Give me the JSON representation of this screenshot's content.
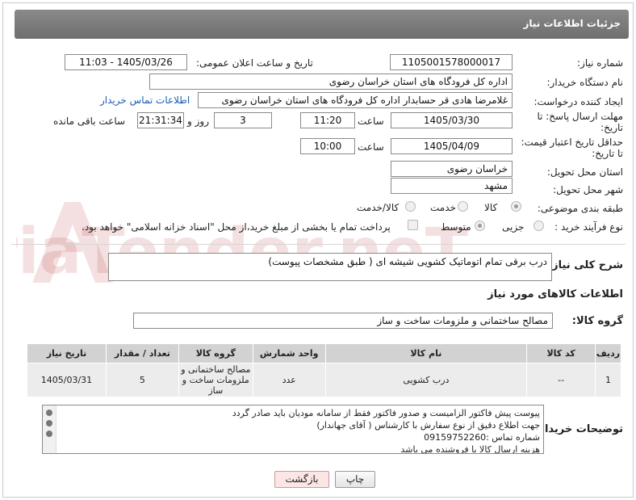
{
  "header": {
    "title": "جزئیات اطلاعات نیاز"
  },
  "fields": {
    "need_number_label": "شماره نیاز:",
    "need_number": "1105001578000017",
    "announce_label": "تاریخ و ساعت اعلان عمومی:",
    "announce_value": "1405/03/26 - 11:03",
    "buyer_org_label": "نام دستگاه خریدار:",
    "buyer_org": "اداره کل فرودگاه های استان خراسان رضوی",
    "creator_label": "ایجاد کننده درخواست:",
    "creator": "غلامرضا هادی قر حسابدار اداره کل فرودگاه های استان خراسان رضوی",
    "buyer_contact_link": "اطلاعات تماس خریدار",
    "deadline_label_1": "مهلت ارسال پاسخ: تا",
    "deadline_label_2": "تاریخ:",
    "deadline_date": "1405/03/30",
    "time_label": "ساعت",
    "deadline_time": "11:20",
    "days_value": "3",
    "days_label": "روز و",
    "remaining_time": "21:31:34",
    "remaining_label": "ساعت باقی مانده",
    "validity_label_1": "حداقل تاریخ اعتبار قیمت:",
    "validity_label_2": "تا تاریخ:",
    "validity_date": "1405/04/09",
    "validity_time": "10:00",
    "province_label": "استان محل تحویل:",
    "province": "خراسان رضوی",
    "city_label": "شهر محل تحویل:",
    "city": "مشهد",
    "category_label": "طبقه بندی موضوعی:",
    "category_options": [
      "کالا",
      "خدمت",
      "کالا/خدمت"
    ],
    "process_label": "نوع فرآیند خرید :",
    "process_options": [
      "جزیی",
      "متوسط"
    ],
    "payment_note": "پرداخت تمام یا بخشی از مبلغ خرید،از محل \"اسناد خزانه اسلامی\" خواهد بود."
  },
  "summary": {
    "label": "شرح کلی نیاز:",
    "text": "درب برقی تمام اتوماتیک کشویی شیشه ای ( طبق مشخصات پیوست)"
  },
  "goods_info_title": "اطلاعات کالاهای مورد نیاز",
  "goods_group": {
    "label": "گروه کالا:",
    "value": "مصالح ساختمانی و ملزومات ساخت و ساز"
  },
  "table": {
    "headers": [
      "ردیف",
      "کد کالا",
      "نام کالا",
      "واحد شمارش",
      "گروه کالا",
      "تعداد / مقدار",
      "تاریخ نیاز"
    ],
    "rows": [
      [
        "1",
        "--",
        "درب کشویی",
        "عدد",
        "مصالح ساختمانی و ملزومات ساخت و ساز",
        "5",
        "1405/03/31"
      ]
    ]
  },
  "buyer_notes": {
    "label": "توضیحات خریدار:",
    "lines": [
      "پیوست پیش فاکتور الزامیست و صدور فاکتور فقط از سامانه مودیان باید صادر گردد",
      "جهت اطلاع دقیق از نوع سفارش با کارشناس  ( آقای جهاندار)",
      "شماره تماس :09159752260",
      "هزینه ارسال کالا با فروشنده می باشد"
    ]
  },
  "buttons": {
    "print": "چاپ",
    "back": "بازگشت"
  },
  "watermark": {
    "text": "AriaTender.neT"
  }
}
